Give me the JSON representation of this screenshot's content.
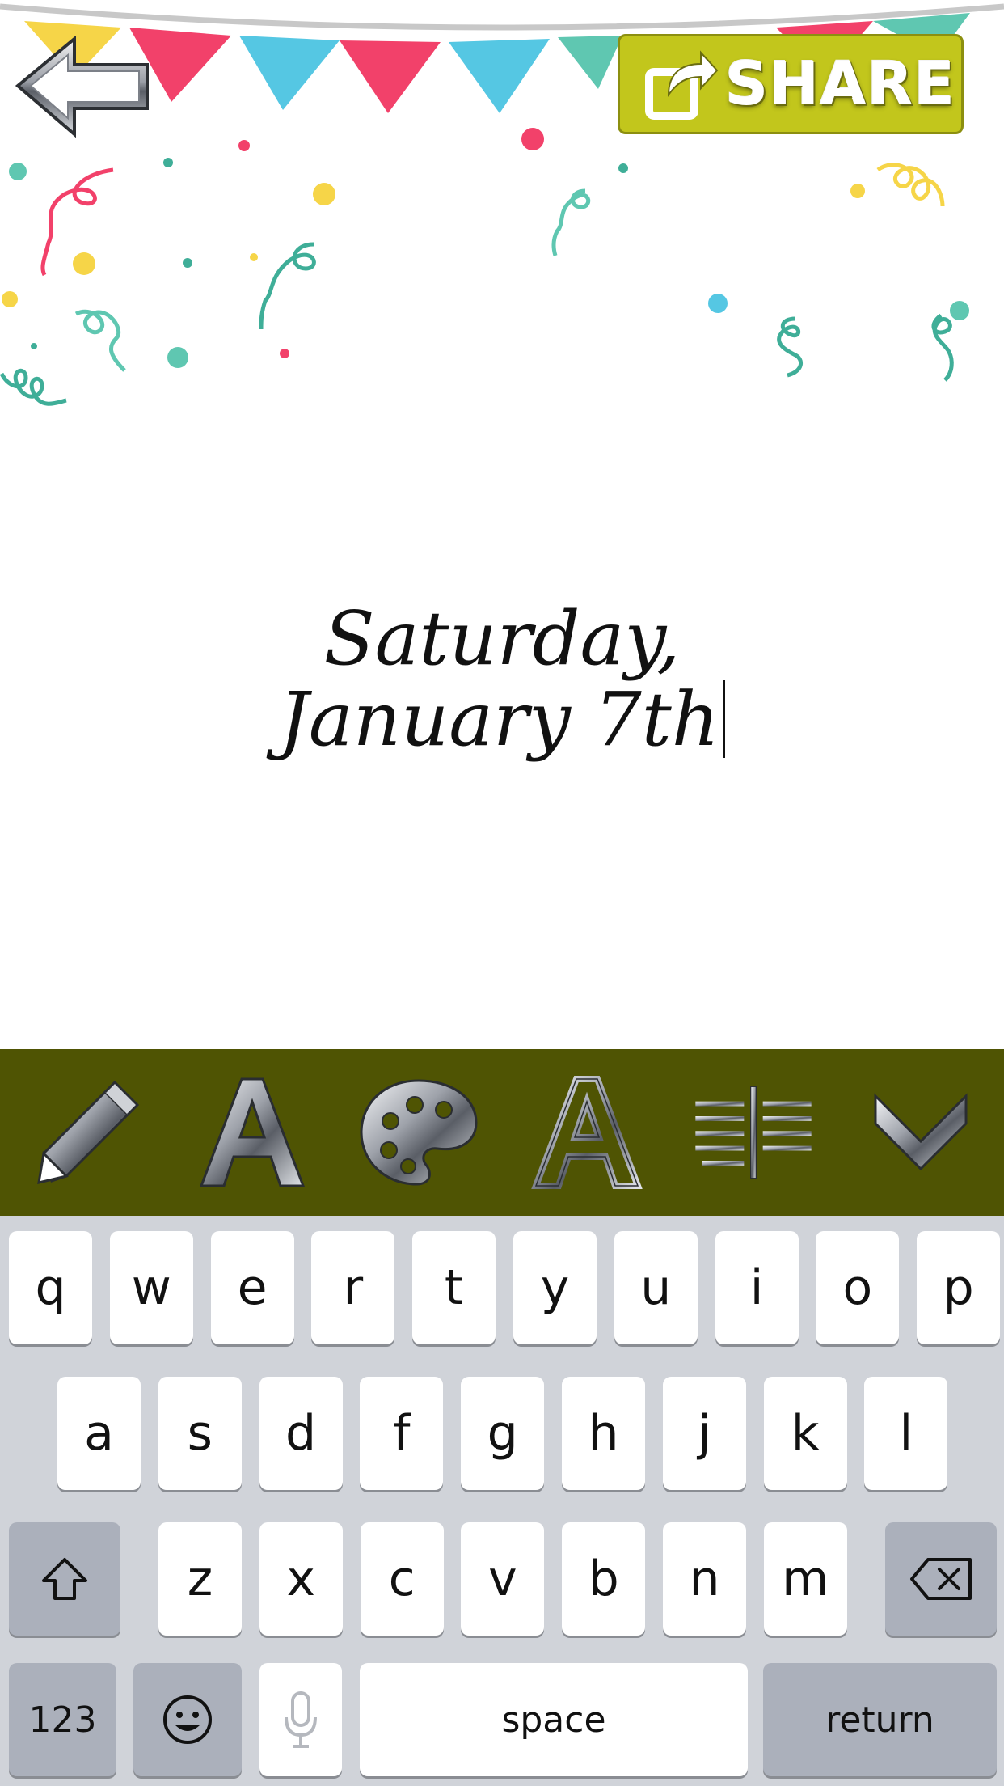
{
  "header": {
    "back_icon": "left-arrow-icon",
    "share_label": "SHARE",
    "share_icon": "share-icon"
  },
  "canvas": {
    "text_line1": "Saturday,",
    "text_line2": "January 7th",
    "bunting_colors": [
      "#f6d548",
      "#f2416a",
      "#55c7e3",
      "#5fc7b1"
    ],
    "confetti_colors": [
      "#f2416a",
      "#f6d548",
      "#55c7e3",
      "#3fae98"
    ]
  },
  "toolbar": {
    "background": "#4f5403",
    "tools": [
      "pencil-icon",
      "font-icon",
      "palette-icon",
      "outline-font-icon",
      "align-center-icon",
      "chevron-down-icon"
    ]
  },
  "keyboard": {
    "row1": [
      "q",
      "w",
      "e",
      "r",
      "t",
      "y",
      "u",
      "i",
      "o",
      "p"
    ],
    "row2": [
      "a",
      "s",
      "d",
      "f",
      "g",
      "h",
      "j",
      "k",
      "l"
    ],
    "row3": [
      "z",
      "x",
      "c",
      "v",
      "b",
      "n",
      "m"
    ],
    "numbers_label": "123",
    "space_label": "space",
    "return_label": "return"
  }
}
